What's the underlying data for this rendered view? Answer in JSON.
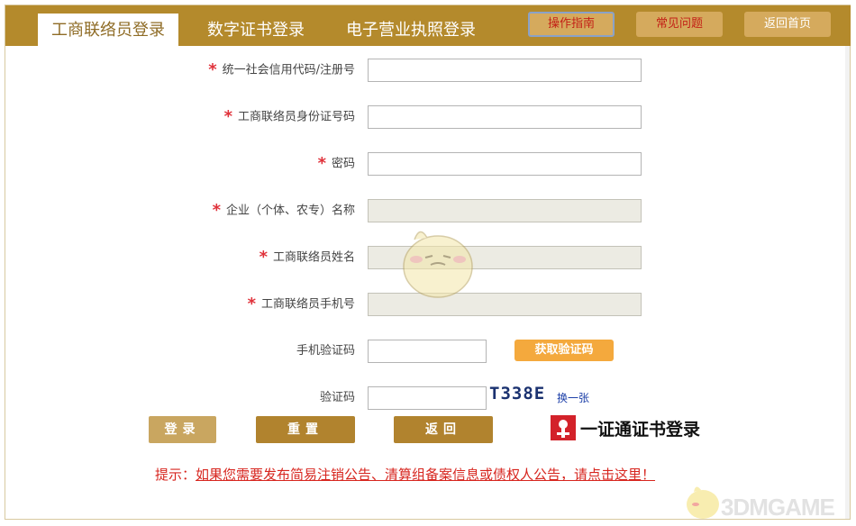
{
  "tabs": [
    "工商联络员登录",
    "数字证书登录",
    "电子营业执照登录"
  ],
  "top_buttons": {
    "guide": "操作指南",
    "faq": "常见问题",
    "home": "返回首页"
  },
  "form": {
    "credit_code_label": "统一社会信用代码/注册号",
    "id_label": "工商联络员身份证号码",
    "password_label": "密码",
    "company_name_label": "企业（个体、农专）名称",
    "contact_name_label": "工商联络员姓名",
    "phone_label": "工商联络员手机号",
    "sms_code_label": "手机验证码",
    "get_code_button": "获取验证码",
    "captcha_label": "验证码",
    "captcha_text": "T338E",
    "change_captcha": "换一张"
  },
  "actions": {
    "login": "登录",
    "reset": "重置",
    "back": "返回"
  },
  "cert_login": "一证通证书登录",
  "notice": {
    "prefix": "提示：",
    "link": "如果您需要发布简易注销公告、清算组备案信息或债权人公告，请点击这里！"
  },
  "watermark": "3DMGAME",
  "colors": {
    "brand": "#b48a2c",
    "required": "#e0313a",
    "accent": "#f4a93d",
    "notice": "#d7261f"
  }
}
